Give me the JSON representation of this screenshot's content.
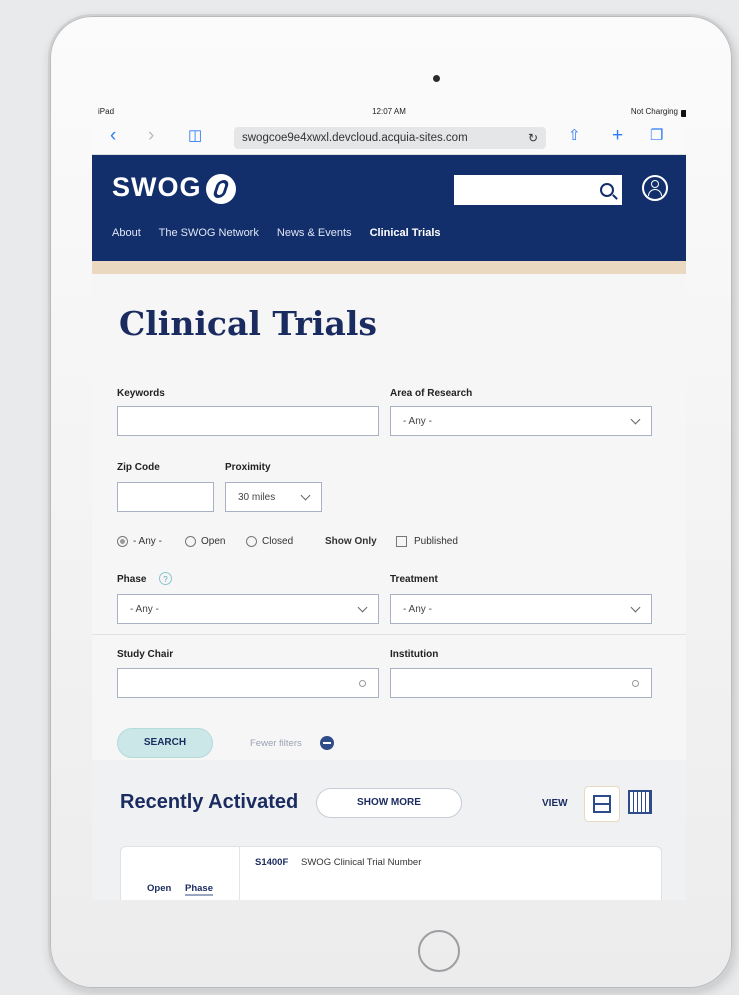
{
  "status": {
    "device": "iPad",
    "time": "12:07 AM",
    "battery": "Not Charging"
  },
  "browser": {
    "url": "swogcoe9e4xwxl.devcloud.acquia-sites.com"
  },
  "header": {
    "logo_text": "SWOG",
    "nav": [
      "About",
      "The SWOG Network",
      "News & Events",
      "Clinical Trials"
    ],
    "active_nav": "Clinical Trials"
  },
  "page": {
    "title": "Clinical Trials"
  },
  "form": {
    "keywords_label": "Keywords",
    "keywords_value": "",
    "area_label": "Area of Research",
    "area_value": "- Any -",
    "zip_label": "Zip Code",
    "zip_value": "",
    "proximity_label": "Proximity",
    "proximity_value": "30 miles",
    "status_options": [
      "- Any -",
      "Open",
      "Closed"
    ],
    "selected_status": "- Any -",
    "show_only_label": "Show Only",
    "published_label": "Published",
    "phase_label": "Phase",
    "phase_help": "?",
    "phase_value": "- Any -",
    "treatment_label": "Treatment",
    "treatment_value": "- Any -",
    "study_chair_label": "Study Chair",
    "study_chair_value": "",
    "institution_label": "Institution",
    "institution_value": "",
    "search_label": "SEARCH",
    "fewer_filters_label": "Fewer filters"
  },
  "recent": {
    "title": "Recently Activated",
    "show_more_label": "SHOW MORE",
    "view_label": "VIEW",
    "card": {
      "open_label": "Open",
      "phase_label": "Phase",
      "trial_id": "S1400F",
      "trial_desc": "SWOG Clinical Trial Number"
    }
  },
  "colors": {
    "navy": "#132f6b",
    "accent": "#ead9c0",
    "button_teal": "#cbe7e7"
  }
}
